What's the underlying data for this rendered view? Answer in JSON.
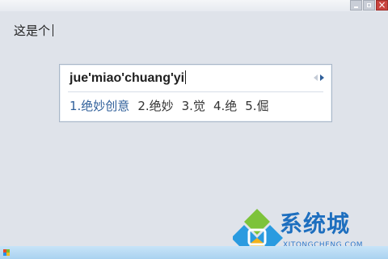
{
  "window": {
    "controls": [
      "minimize",
      "maximize",
      "close"
    ]
  },
  "editor": {
    "text": "这是个"
  },
  "ime": {
    "composition": "jue'miao'chuang'yi",
    "pager_icons": [
      "prev-page-icon",
      "next-page-icon"
    ],
    "candidates": [
      {
        "label": "1.绝妙创意",
        "selected": true
      },
      {
        "label": "2.绝妙",
        "selected": false
      },
      {
        "label": "3.觉",
        "selected": false
      },
      {
        "label": "4.绝",
        "selected": false
      },
      {
        "label": "5.倔",
        "selected": false
      }
    ]
  },
  "watermark": {
    "title": "系统城",
    "url": "XITONGCHENG.COM"
  },
  "taskbar": {
    "icon": "windows-start-icon"
  },
  "colors": {
    "background": "#dfe3ea",
    "selected_candidate": "#2f5f9a",
    "watermark_blue": "#1e6fbf",
    "close_button": "#c9433d"
  }
}
